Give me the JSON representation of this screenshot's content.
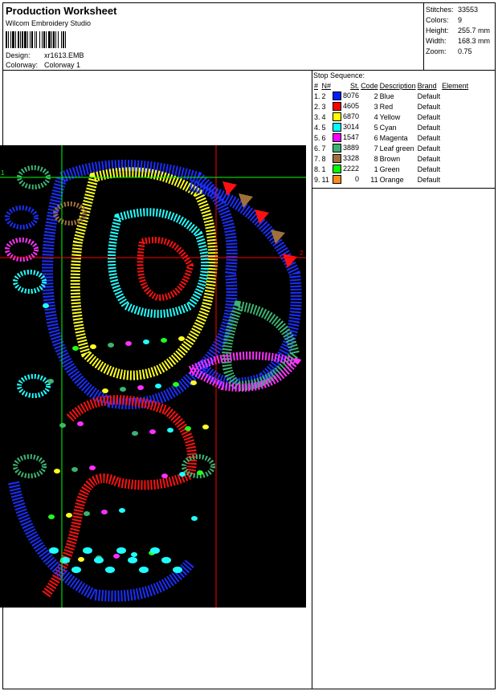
{
  "header": {
    "title": "Production Worksheet",
    "app_name": "Wilcom Embroidery Studio",
    "design_label": "Design:",
    "design_value": "xr1613.EMB",
    "colorway_label": "Colorway:",
    "colorway_value": "Colorway 1"
  },
  "stats": [
    {
      "label": "Stitches:",
      "value": "33553"
    },
    {
      "label": "Colors:",
      "value": "9"
    },
    {
      "label": "Height:",
      "value": "255.7 mm"
    },
    {
      "label": "Width:",
      "value": "168.3 mm"
    },
    {
      "label": "Zoom:",
      "value": "0.75"
    }
  ],
  "stop_sequence": {
    "title": "Stop Sequence:",
    "columns": [
      "#",
      "N#",
      "St.",
      "Code",
      "Description",
      "Brand",
      "Element"
    ],
    "rows": [
      {
        "idx": "1.",
        "n": "2",
        "color": "#0020ff",
        "st": "8076",
        "code": "2",
        "desc": "Blue",
        "brand": "Default"
      },
      {
        "idx": "2.",
        "n": "3",
        "color": "#ff0000",
        "st": "4605",
        "code": "3",
        "desc": "Red",
        "brand": "Default"
      },
      {
        "idx": "3.",
        "n": "4",
        "color": "#ffff00",
        "st": "6870",
        "code": "4",
        "desc": "Yellow",
        "brand": "Default"
      },
      {
        "idx": "4.",
        "n": "5",
        "color": "#00ffff",
        "st": "3014",
        "code": "5",
        "desc": "Cyan",
        "brand": "Default"
      },
      {
        "idx": "5.",
        "n": "6",
        "color": "#ff00ff",
        "st": "1547",
        "code": "6",
        "desc": "Magenta",
        "brand": "Default"
      },
      {
        "idx": "6.",
        "n": "7",
        "color": "#3cb371",
        "st": "3889",
        "code": "7",
        "desc": "Leaf green",
        "brand": "Default"
      },
      {
        "idx": "7.",
        "n": "8",
        "color": "#a0703c",
        "st": "3328",
        "code": "8",
        "desc": "Brown",
        "brand": "Default"
      },
      {
        "idx": "8.",
        "n": "1",
        "color": "#00ff00",
        "st": "2222",
        "code": "1",
        "desc": "Green",
        "brand": "Default"
      },
      {
        "idx": "9.",
        "n": "11",
        "color": "#ff8c1a",
        "st": "0",
        "code": "11",
        "desc": "Orange",
        "brand": "Default"
      }
    ]
  },
  "design_preview": {
    "guide_labels": [
      "1",
      "2"
    ],
    "guide_color_v": "#00ff00",
    "guide_color_h": "#ff0000"
  }
}
